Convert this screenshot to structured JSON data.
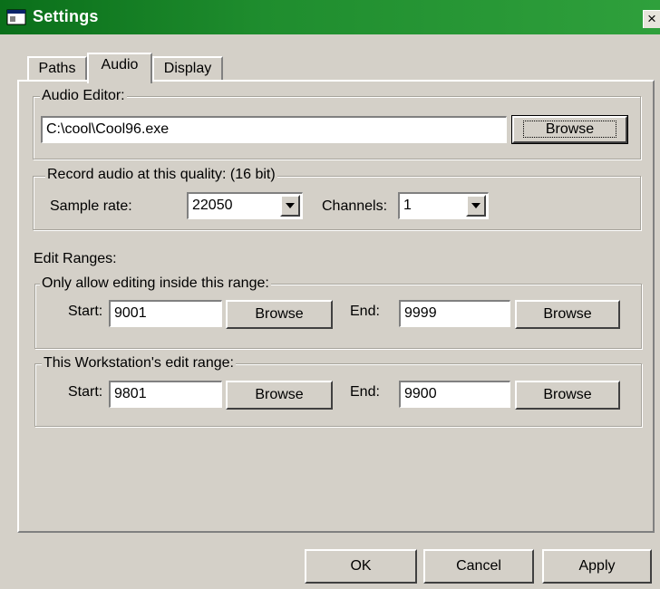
{
  "window": {
    "title": "Settings",
    "close_glyph": "×"
  },
  "tabs": [
    {
      "label": "Paths",
      "active": false
    },
    {
      "label": "Audio",
      "active": true
    },
    {
      "label": "Display",
      "active": false
    }
  ],
  "audio_editor": {
    "legend": "Audio Editor:",
    "path": "C:\\cool\\Cool96.exe",
    "browse": "Browse"
  },
  "record": {
    "legend": "Record audio at this quality: (16 bit)",
    "sample_rate_label": "Sample rate:",
    "sample_rate": "22050",
    "channels_label": "Channels:",
    "channels": "1"
  },
  "edit_ranges": {
    "heading": "Edit Ranges:",
    "allowed": {
      "legend": "Only allow editing inside this range:",
      "start_label": "Start:",
      "start": "9001",
      "end_label": "End:",
      "end": "9999",
      "browse": "Browse"
    },
    "workstation": {
      "legend": "This Workstation's edit range:",
      "start_label": "Start:",
      "start": "9801",
      "end_label": "End:",
      "end": "9900",
      "browse": "Browse"
    }
  },
  "footer": {
    "ok": "OK",
    "cancel": "Cancel",
    "apply": "Apply"
  },
  "colors": {
    "titlebar": "#1f8d2e",
    "face": "#d4d0c8"
  },
  "icons": {
    "app": "app-window-icon",
    "close": "close-icon",
    "dropdown": "chevron-down-icon"
  }
}
